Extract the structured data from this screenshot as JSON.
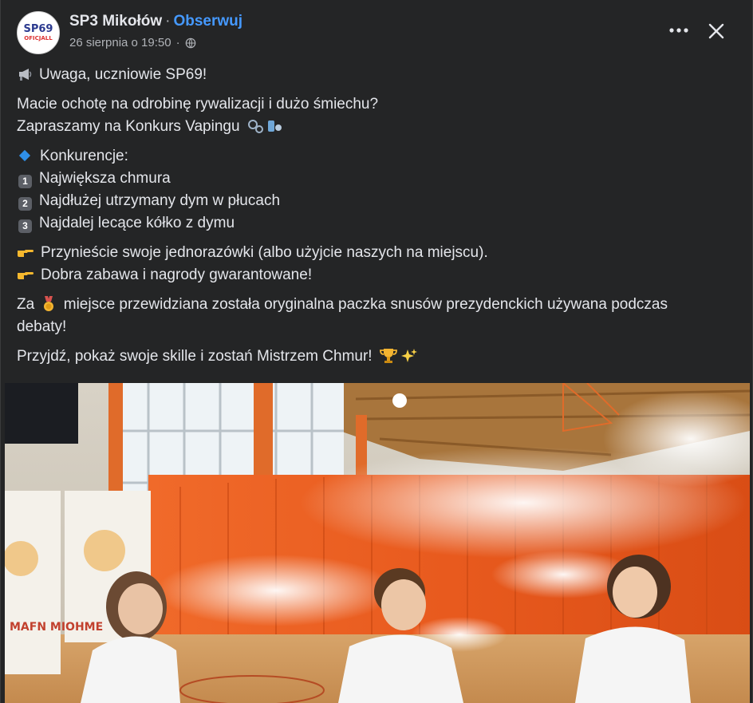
{
  "post": {
    "page_name": "SP3 Mikołów",
    "separator": "·",
    "follow_label": "Obserwuj",
    "timestamp": "26 sierpnia o 19:50",
    "meta_separator": "·",
    "avatar_text_top": "SP69",
    "avatar_text_bottom": "OFICJALL",
    "text": {
      "line1": "Uwaga, uczniowie SP69!",
      "line2": "Macie ochotę na odrobinę rywalizacji i dużo śmiechu?",
      "line3": "Zapraszamy na Konkurs Vapingu",
      "competitions_header": "Konkurencje:",
      "competitions": [
        {
          "num": "1",
          "text": "Największa chmura"
        },
        {
          "num": "2",
          "text": "Najdłużej utrzymany dym w płucach"
        },
        {
          "num": "3",
          "text": "Najdalej lecące kółko z dymu"
        }
      ],
      "point1": "Przynieście swoje jednorazówki (albo użyjcie naszych na miejscu).",
      "point2": "Dobra zabawa i nagrody gwarantowane!",
      "prize_before": "Za",
      "prize_after": "miejsce przewidziana została oryginalna paczka snusów prezydenckich używana podczas",
      "prize_line2": "debaty!",
      "closing": "Przyjdź, pokaż swoje skille i zostań Mistrzem Chmur!"
    },
    "banner_text": "MAFN MIOHME"
  },
  "icons": {
    "megaphone": "megaphone-icon",
    "bubbles": "bubbles-icon",
    "diamond": "blue-diamond-icon",
    "pointing": "pointing-hand-icon",
    "medal": "medal-icon",
    "trophy": "trophy-icon",
    "sparkles": "sparkles-icon",
    "globe": "globe-icon",
    "more": "more-options-icon",
    "close": "close-icon"
  },
  "colors": {
    "background": "#242526",
    "text": "#e4e6eb",
    "secondary": "#b0b3b8",
    "link": "#4599ff",
    "curtain": "#e85a1e"
  }
}
